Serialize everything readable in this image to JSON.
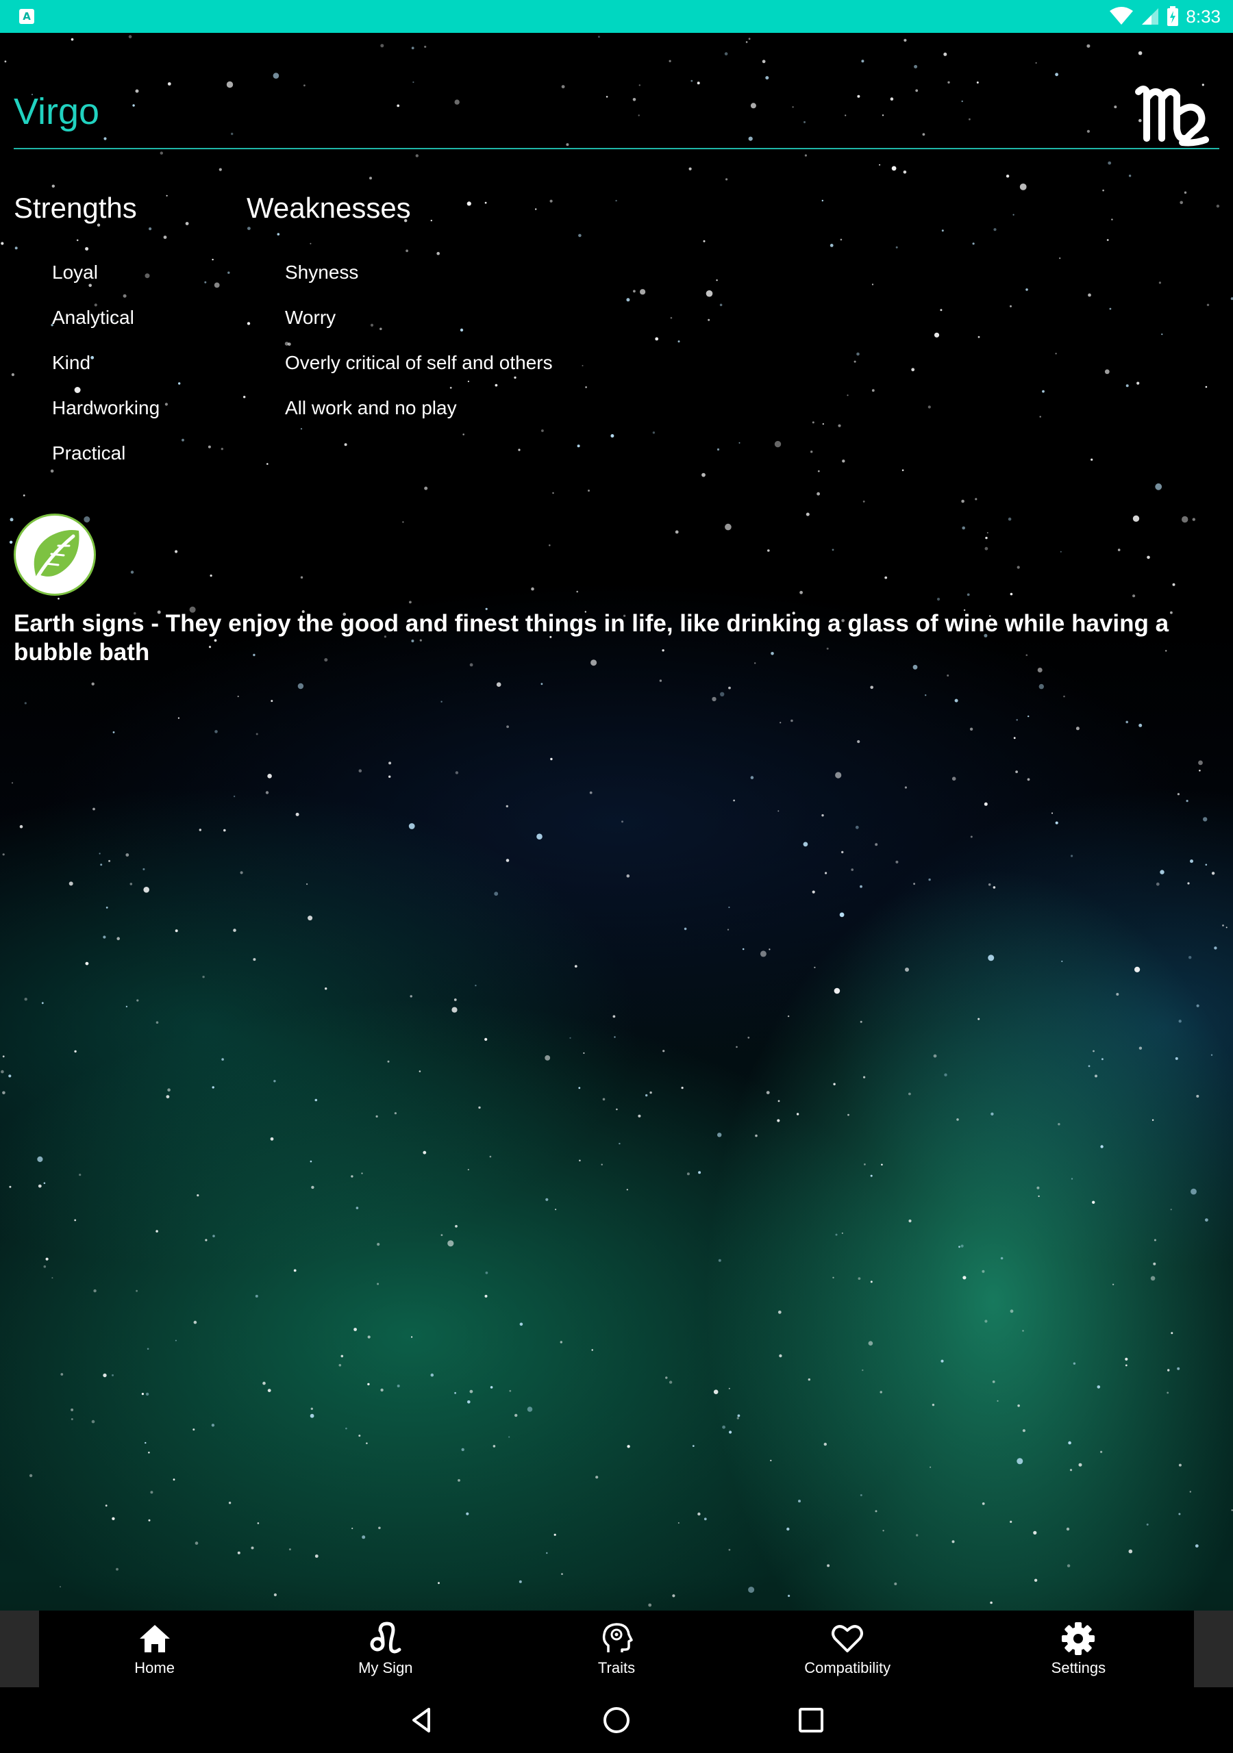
{
  "status_bar": {
    "time": "8:33",
    "notification_icon": "A"
  },
  "header": {
    "title": "Virgo",
    "symbol_icon": "virgo-symbol-icon"
  },
  "strengths": {
    "heading": "Strengths",
    "items": [
      "Loyal",
      "Analytical",
      "Kind",
      "Hardworking",
      "Practical"
    ]
  },
  "weaknesses": {
    "heading": "Weaknesses",
    "items": [
      "Shyness",
      "Worry",
      "Overly critical of self and others",
      "All work and no play"
    ]
  },
  "element": {
    "icon": "leaf-icon",
    "description": "Earth signs - They enjoy the good and finest things in life, like drinking a glass of wine while having a bubble bath"
  },
  "bottom_nav": {
    "items": [
      {
        "label": "Home",
        "icon": "home-icon"
      },
      {
        "label": "My Sign",
        "icon": "leo-symbol-icon"
      },
      {
        "label": "Traits",
        "icon": "head-gear-icon"
      },
      {
        "label": "Compatibility",
        "icon": "heart-icon"
      },
      {
        "label": "Settings",
        "icon": "gear-icon"
      }
    ]
  },
  "colors": {
    "status_bar": "#00d7c1",
    "accent": "#21d2c0",
    "leaf": "#7dc242"
  }
}
